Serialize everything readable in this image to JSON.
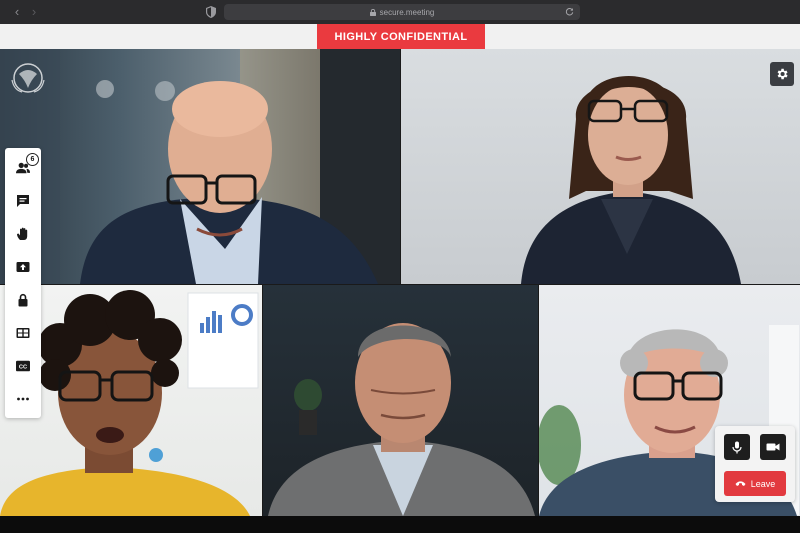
{
  "browser": {
    "address": "secure.meeting",
    "icons": [
      "back-arrow-icon",
      "forward-arrow-icon",
      "shield-icon",
      "lock-icon",
      "reload-icon"
    ]
  },
  "banner": {
    "label": "HIGHLY CONFIDENTIAL",
    "color": "#ea3a3f"
  },
  "sidebar": {
    "participant_count": "6",
    "items": [
      {
        "icon": "participants-icon"
      },
      {
        "icon": "chat-icon"
      },
      {
        "icon": "raise-hand-icon"
      },
      {
        "icon": "share-screen-icon"
      },
      {
        "icon": "lock-icon"
      },
      {
        "icon": "layout-grid-icon"
      },
      {
        "icon": "captions-icon"
      },
      {
        "icon": "more-icon"
      }
    ],
    "captions_label": "CC"
  },
  "participants": [
    {
      "tile": "participant-tile-1"
    },
    {
      "tile": "participant-tile-2"
    },
    {
      "tile": "participant-tile-3"
    },
    {
      "tile": "participant-tile-4"
    },
    {
      "tile": "participant-tile-5"
    }
  ],
  "controls": {
    "leave_label": "Leave",
    "mic_icon": "microphone-icon",
    "camera_icon": "camera-icon",
    "leave_color": "#e23a3f"
  },
  "settings": {
    "icon": "gear-icon"
  }
}
